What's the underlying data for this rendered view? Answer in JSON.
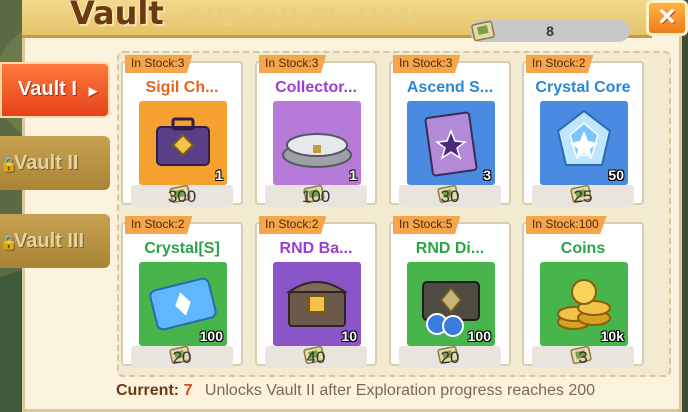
{
  "header": {
    "title": "Vault",
    "close_label": "×"
  },
  "currency": {
    "icon": "ticket-icon",
    "amount": "8"
  },
  "tabs": [
    {
      "label": "Vault I",
      "state": "active",
      "arrow": "▶"
    },
    {
      "label": "Vault II",
      "state": "locked"
    },
    {
      "label": "Vault III",
      "state": "locked"
    }
  ],
  "items": [
    {
      "stock": "In Stock:3",
      "name": "Sigil Ch...",
      "name_color": "#e8641c",
      "qty": "1",
      "price": "300",
      "icon": "briefcase-icon",
      "art_color": "#f6a030"
    },
    {
      "stock": "In Stock:3",
      "name": "Collector...",
      "name_color": "#9b3ed1",
      "qty": "1",
      "price": "100",
      "icon": "pedestal-icon",
      "art_color": "#b67ad8"
    },
    {
      "stock": "In Stock:3",
      "name": "Ascend S...",
      "name_color": "#2a86d6",
      "qty": "3",
      "price": "30",
      "icon": "scroll-icon",
      "art_color": "#4a8ae0"
    },
    {
      "stock": "In Stock:2",
      "name": "Crystal Core",
      "name_color": "#2a86d6",
      "qty": "50",
      "price": "25",
      "icon": "crystal-icon",
      "art_color": "#4a8ae0"
    },
    {
      "stock": "In Stock:2",
      "name": "Crystal[S]",
      "name_color": "#2aa34a",
      "qty": "100",
      "price": "20",
      "icon": "ticket-crystal-icon",
      "art_color": "#47b54b"
    },
    {
      "stock": "In Stock:2",
      "name": "RND Ba...",
      "name_color": "#9b3ed1",
      "qty": "10",
      "price": "40",
      "icon": "chest-icon",
      "art_color": "#8a55c8"
    },
    {
      "stock": "In Stock:5",
      "name": "RND Di...",
      "name_color": "#2aa34a",
      "qty": "100",
      "price": "20",
      "icon": "dice-case-icon",
      "art_color": "#47b54b"
    },
    {
      "stock": "In Stock:100",
      "name": "Coins",
      "name_color": "#2aa34a",
      "qty": "10k",
      "price": "3",
      "icon": "coins-icon",
      "art_color": "#47b54b"
    }
  ],
  "footer": {
    "current_label": "Current:",
    "current_value": "7",
    "message": "Unlocks Vault II after Exploration progress reaches 200"
  }
}
